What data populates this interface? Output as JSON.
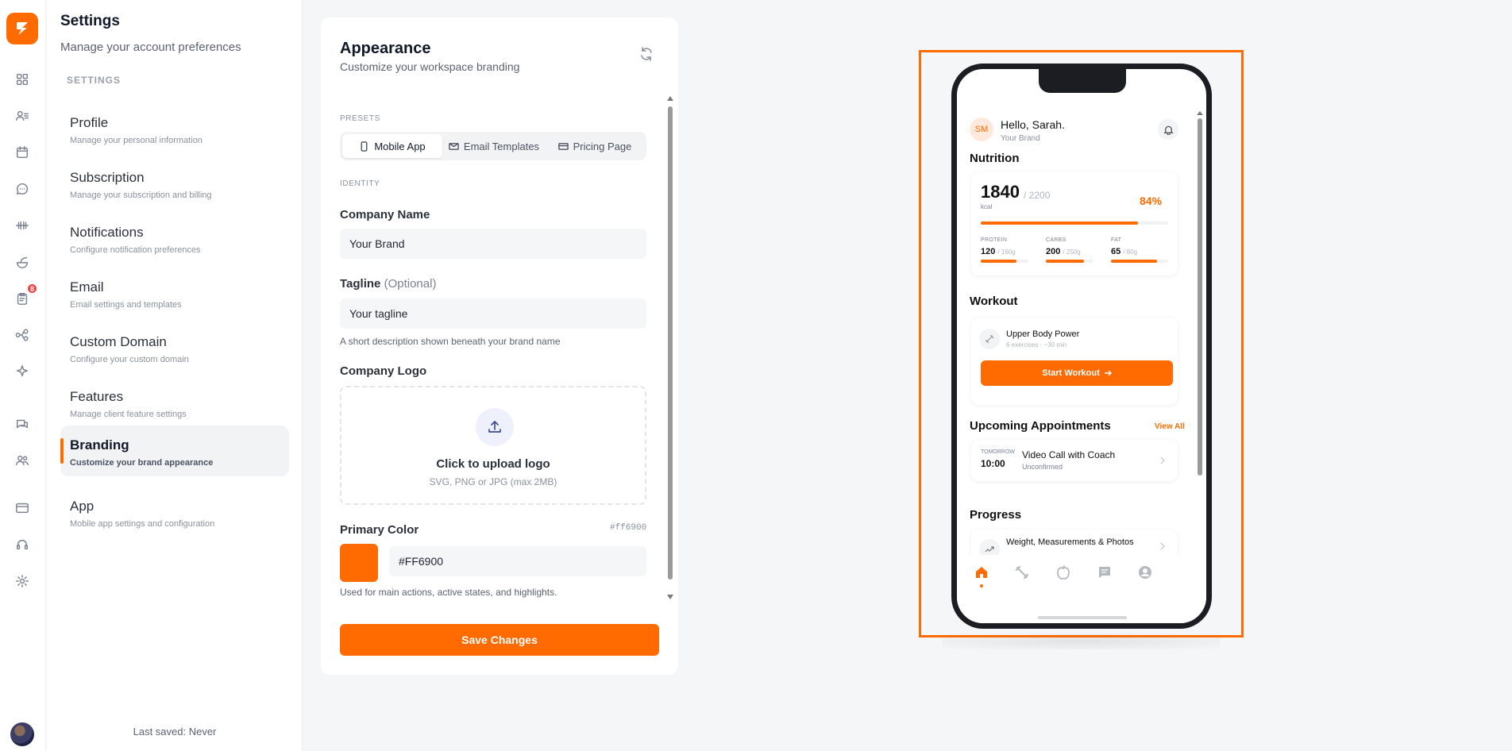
{
  "rail": {
    "icons": [
      "dashboard-icon",
      "clients-icon",
      "calendar-icon",
      "messages-icon",
      "dumbbell-icon",
      "nutrition-icon",
      "clipboard-icon",
      "workflow-icon",
      "sparkle-icon",
      "chat-icon",
      "team-icon",
      "billing-icon",
      "support-icon",
      "settings-icon"
    ],
    "badge_count": "8"
  },
  "sidebar": {
    "title": "Settings",
    "subtitle": "Manage your account preferences",
    "section": "SETTINGS",
    "items": [
      {
        "title": "Profile",
        "desc": "Manage your personal information"
      },
      {
        "title": "Subscription",
        "desc": "Manage your subscription and billing"
      },
      {
        "title": "Notifications",
        "desc": "Configure notification preferences"
      },
      {
        "title": "Email",
        "desc": "Email settings and templates"
      },
      {
        "title": "Custom Domain",
        "desc": "Configure your custom domain"
      },
      {
        "title": "Features",
        "desc": "Manage client feature settings"
      },
      {
        "title": "Branding",
        "desc": "Customize your brand appearance"
      },
      {
        "title": "App",
        "desc": "Mobile app settings and configuration"
      }
    ],
    "active": "Branding",
    "last_saved": "Last saved: Never"
  },
  "appearance": {
    "title": "Appearance",
    "subtitle": "Customize your workspace branding",
    "presets_label": "PRESETS",
    "presets": [
      "Mobile App",
      "Email Templates",
      "Pricing Page"
    ],
    "active_preset": "Mobile App",
    "identity_label": "IDENTITY",
    "company_name_label": "Company Name",
    "company_name_value": "Your Brand",
    "tagline_label": "Tagline",
    "tagline_optional": "(Optional)",
    "tagline_value": "Your tagline",
    "tagline_hint": "A short description shown beneath your brand name",
    "logo_label": "Company Logo",
    "upload_title": "Click to upload logo",
    "upload_hint": "SVG, PNG or JPG (max 2MB)",
    "primary_color_label": "Primary Color",
    "primary_color_hex_label": "#ff6900",
    "primary_color_value": "#FF6900",
    "primary_color_hint": "Used for main actions, active states, and highlights.",
    "save_label": "Save Changes"
  },
  "preview": {
    "avatar_initials": "SM",
    "greeting": "Hello, Sarah.",
    "brand": "Your Brand",
    "nutrition_title": "Nutrition",
    "kcal_value": "1840",
    "kcal_goal": "/ 2200",
    "kcal_unit": "kcal",
    "kcal_percent": "84%",
    "kcal_progress": 0.84,
    "macros": [
      {
        "label": "PROTEIN",
        "value": "120",
        "goal": "/ 160g",
        "progress": 0.75
      },
      {
        "label": "CARBS",
        "value": "200",
        "goal": "/ 250g",
        "progress": 0.8
      },
      {
        "label": "FAT",
        "value": "65",
        "goal": "/ 80g",
        "progress": 0.81
      }
    ],
    "workout_title": "Workout",
    "workout_name": "Upper Body Power",
    "workout_meta": "6 exercises · ~30 min",
    "start_workout": "Start Workout",
    "appointments_title": "Upcoming Appointments",
    "view_all": "View All",
    "appt_day": "TOMORROW",
    "appt_time": "10:00",
    "appt_title": "Video Call with Coach",
    "appt_status": "Unconfirmed",
    "progress_title": "Progress",
    "progress_item": "Weight, Measurements & Photos",
    "tabbar": [
      "home-icon",
      "workout-icon",
      "nutrition-icon",
      "chat-icon",
      "profile-icon"
    ],
    "accent": "#ff6b00"
  }
}
